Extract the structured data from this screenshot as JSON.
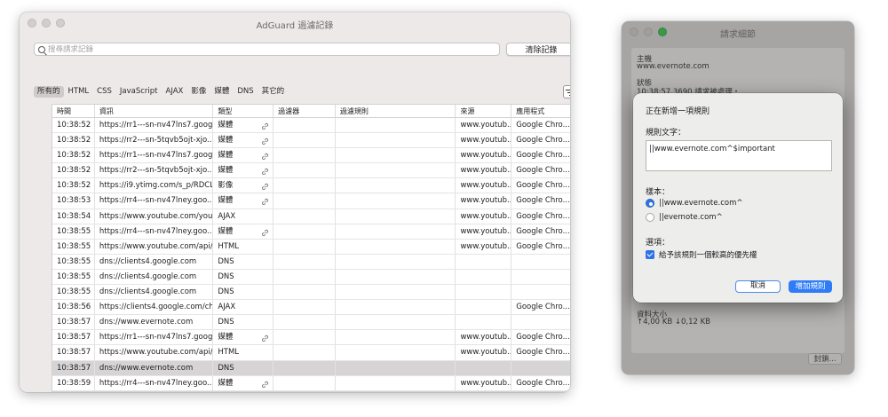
{
  "main_window": {
    "title": "AdGuard 過濾記錄",
    "search_placeholder": "搜尋請求記錄",
    "clear_label": "清除記錄",
    "filters": [
      "所有的",
      "HTML",
      "CSS",
      "JavaScript",
      "AJAX",
      "影像",
      "媒體",
      "DNS",
      "其它的"
    ],
    "active_filter": "所有的",
    "columns": [
      "時間",
      "資訊",
      "類型",
      "過濾器",
      "過濾規則",
      "來源",
      "應用程式"
    ],
    "rows": [
      {
        "time": "10:38:52",
        "url": "https://rr1---sn-nv47lns7.goog...",
        "type": "媒體",
        "link": true,
        "source": "www.youtub...",
        "app": "Google Chro..."
      },
      {
        "time": "10:38:52",
        "url": "https://rr2---sn-5tqvb5ojt-xjo...",
        "type": "媒體",
        "link": true,
        "source": "www.youtub...",
        "app": "Google Chro..."
      },
      {
        "time": "10:38:52",
        "url": "https://rr1---sn-nv47lns7.goog...",
        "type": "媒體",
        "link": true,
        "source": "www.youtub...",
        "app": "Google Chro..."
      },
      {
        "time": "10:38:52",
        "url": "https://rr2---sn-5tqvb5ojt-xjo...",
        "type": "媒體",
        "link": true,
        "source": "www.youtub...",
        "app": "Google Chro..."
      },
      {
        "time": "10:38:52",
        "url": "https://i9.ytimg.com/s_p/RDCL...",
        "type": "影像",
        "link": true,
        "source": "www.youtub...",
        "app": "Google Chro..."
      },
      {
        "time": "10:38:53",
        "url": "https://rr4---sn-nv47lney.goo...",
        "type": "媒體",
        "link": true,
        "source": "www.youtub...",
        "app": "Google Chro..."
      },
      {
        "time": "10:38:54",
        "url": "https://www.youtube.com/yout...",
        "type": "AJAX",
        "link": false,
        "source": "www.youtub...",
        "app": "Google Chro..."
      },
      {
        "time": "10:38:55",
        "url": "https://rr4---sn-nv47lney.goo...",
        "type": "媒體",
        "link": true,
        "source": "www.youtub...",
        "app": "Google Chro..."
      },
      {
        "time": "10:38:55",
        "url": "https://www.youtube.com/api/...",
        "type": "HTML",
        "link": false,
        "source": "www.youtub...",
        "app": "Google Chro..."
      },
      {
        "time": "10:38:55",
        "url": "dns://clients4.google.com",
        "type": "DNS",
        "link": false,
        "source": "",
        "app": ""
      },
      {
        "time": "10:38:55",
        "url": "dns://clients4.google.com",
        "type": "DNS",
        "link": false,
        "source": "",
        "app": ""
      },
      {
        "time": "10:38:55",
        "url": "dns://clients4.google.com",
        "type": "DNS",
        "link": false,
        "source": "",
        "app": ""
      },
      {
        "time": "10:38:56",
        "url": "https://clients4.google.com/ch...",
        "type": "AJAX",
        "link": false,
        "source": "",
        "app": "Google Chro..."
      },
      {
        "time": "10:38:57",
        "url": "dns://www.evernote.com",
        "type": "DNS",
        "link": false,
        "source": "",
        "app": ""
      },
      {
        "time": "10:38:57",
        "url": "https://rr1---sn-nv47lns7.goog...",
        "type": "媒體",
        "link": true,
        "source": "www.youtub...",
        "app": "Google Chro..."
      },
      {
        "time": "10:38:57",
        "url": "https://www.youtube.com/api/...",
        "type": "HTML",
        "link": false,
        "source": "www.youtub...",
        "app": "Google Chro..."
      },
      {
        "time": "10:38:57",
        "url": "dns://www.evernote.com",
        "type": "DNS",
        "link": false,
        "source": "",
        "app": "",
        "selected": true
      },
      {
        "time": "10:38:59",
        "url": "https://rr4---sn-nv47lney.goo...",
        "type": "媒體",
        "link": true,
        "source": "www.youtub...",
        "app": "Google Chro..."
      }
    ]
  },
  "detail_window": {
    "title": "請求細節",
    "host_label": "主機",
    "host_value": "www.evernote.com",
    "status_label": "狀態",
    "status_value": "10:38:57.3690 請求被處理・",
    "size_label": "資料大小",
    "size_value": "↑4,00 KB ↓0,12 KB",
    "copy_label": "封鎖..."
  },
  "sheet": {
    "title": "正在新增一項規則",
    "rule_text_label": "規則文字：",
    "rule_text": "||www.evernote.com^$important",
    "pattern_label": "樣本：",
    "patterns": [
      "||www.evernote.com^",
      "||evernote.com^"
    ],
    "selected_pattern": 0,
    "options_label": "選項：",
    "option_important": "給予該規則一個較高的優先權",
    "cancel_label": "取消",
    "add_label": "增加規則"
  },
  "colors": {
    "accent": "#2f7cf6",
    "selected_row": "#d6d4d4",
    "window_bg": "#ede9e9"
  }
}
